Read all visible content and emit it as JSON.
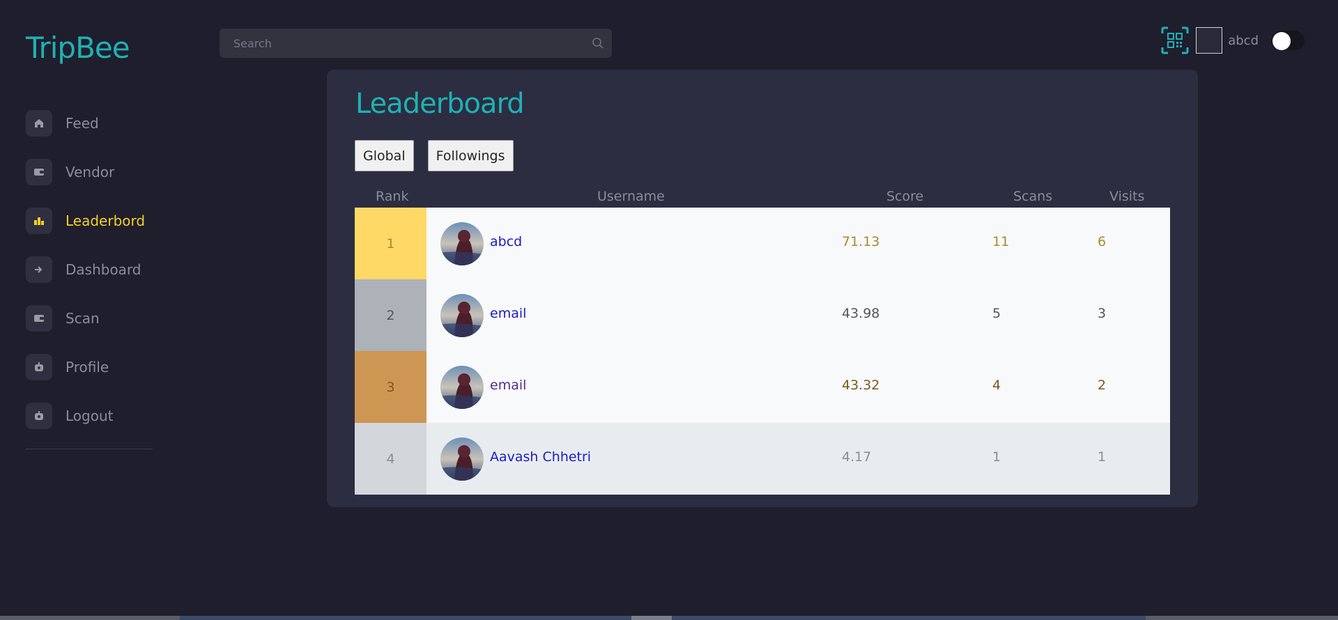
{
  "brand": {
    "name": "TripBee"
  },
  "sidebar": {
    "items": [
      {
        "label": "Feed",
        "icon": "home-icon",
        "active": false
      },
      {
        "label": "Vendor",
        "icon": "wallet-icon",
        "active": false
      },
      {
        "label": "Leaderbord",
        "icon": "bar-chart-icon",
        "active": true
      },
      {
        "label": "Dashboard",
        "icon": "arrow-right-icon",
        "active": false
      },
      {
        "label": "Scan",
        "icon": "wallet-icon",
        "active": false
      },
      {
        "label": "Profile",
        "icon": "user-icon",
        "active": false
      },
      {
        "label": "Logout",
        "icon": "logout-icon",
        "active": false
      }
    ]
  },
  "search": {
    "placeholder": "Search",
    "value": ""
  },
  "header": {
    "username": "abcd"
  },
  "leaderboard": {
    "title": "Leaderboard",
    "tabs": [
      "Global",
      "Followings"
    ],
    "columns": {
      "rank": "Rank",
      "username": "Username",
      "score": "Score",
      "scans": "Scans",
      "visits": "Visits"
    },
    "rows": [
      {
        "rank": "1",
        "username": "abcd",
        "score": "71.13",
        "scans": "11",
        "visits": "6",
        "rank_bg": "#ffd966",
        "text_color": "#a88a2e",
        "name_color": "#1a1ac8"
      },
      {
        "rank": "2",
        "username": "email",
        "score": "43.98",
        "scans": "5",
        "visits": "3",
        "rank_bg": "#adb2b8",
        "text_color": "#54575c",
        "name_color": "#1a1ac8"
      },
      {
        "rank": "3",
        "username": "email",
        "score": "43.32",
        "scans": "4",
        "visits": "2",
        "rank_bg": "#cd9653",
        "text_color": "#7e561e",
        "name_color": "#5a2b86"
      },
      {
        "rank": "4",
        "username": "Aavash Chhetri",
        "score": "4.17",
        "scans": "1",
        "visits": "1",
        "rank_bg": "#d3d6db",
        "text_color": "#8a8d92",
        "name_color": "#1a1ac8"
      }
    ]
  },
  "colors": {
    "accent": "#1fb1b5",
    "active": "#f4cf2b",
    "background": "#1f1e2d",
    "card": "#2c2d40"
  }
}
